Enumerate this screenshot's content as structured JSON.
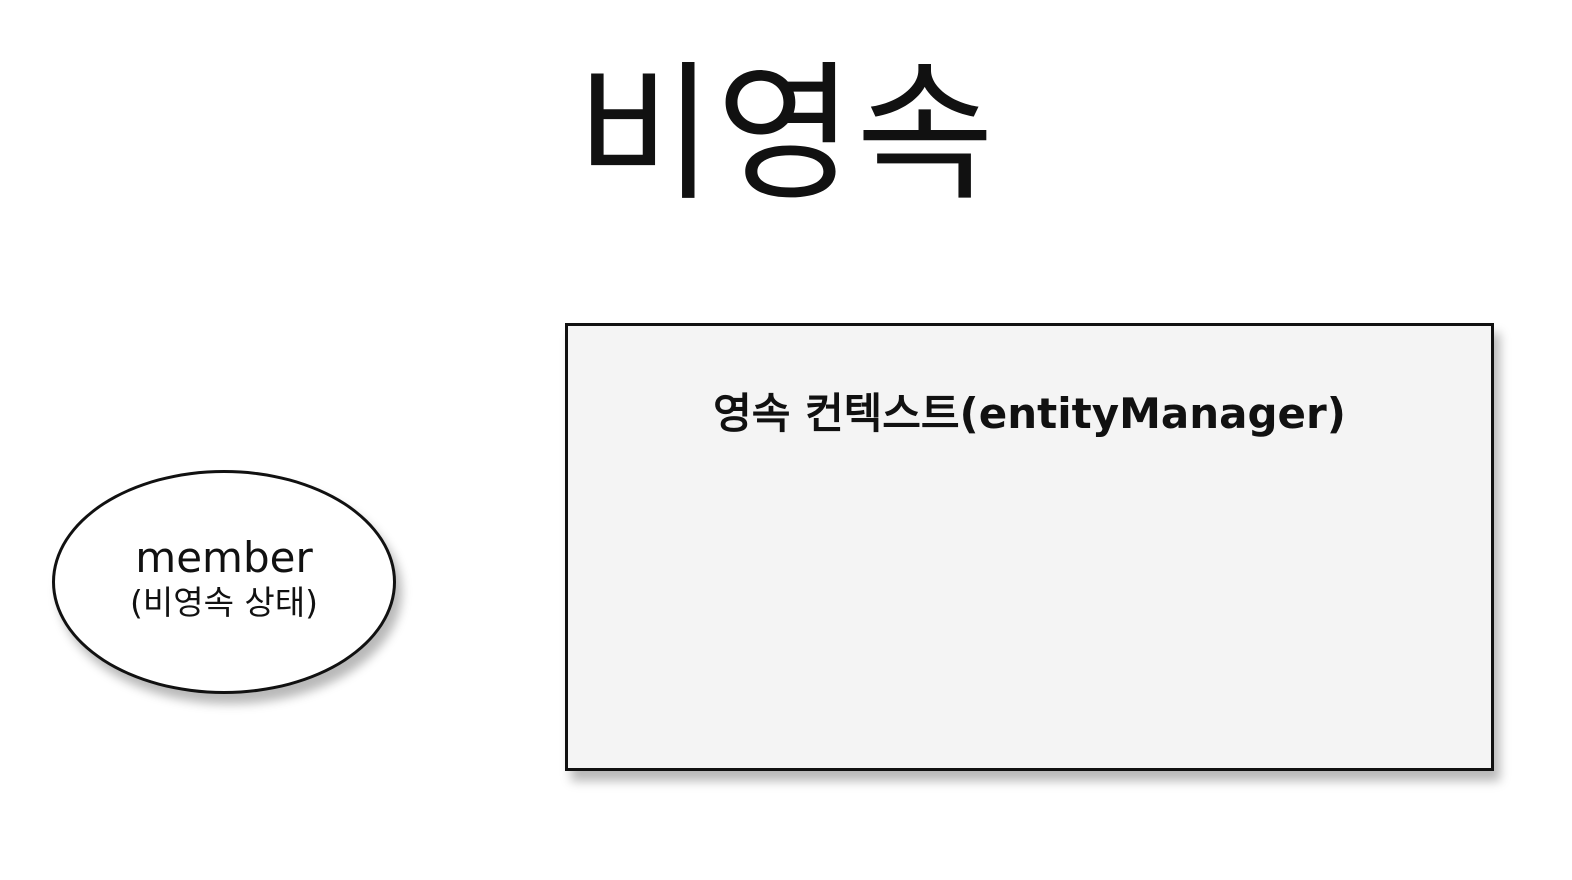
{
  "title": "비영속",
  "entity": {
    "name": "member",
    "state": "(비영속 상태)"
  },
  "persistence_context": {
    "label": "영속 컨텍스트(entityManager)"
  }
}
